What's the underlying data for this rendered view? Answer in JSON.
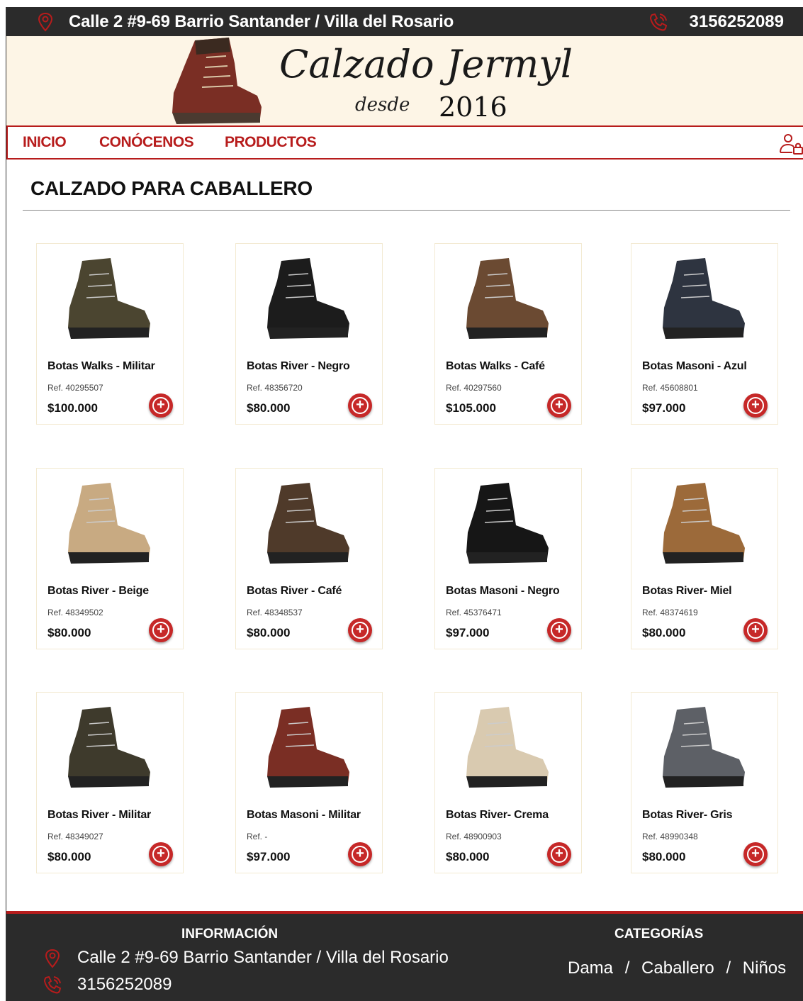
{
  "topbar": {
    "address": "Calle 2 #9-69 Barrio Santander / Villa del Rosario",
    "phone": "3156252089"
  },
  "header": {
    "brand": "Calzado Jermyl",
    "since_label": "desde",
    "since_year": "2016"
  },
  "nav": {
    "items": [
      "INICIO",
      "CONÓCENOS",
      "PRODUCTOS"
    ]
  },
  "section_title": "CALZADO PARA CABALLERO",
  "products": [
    {
      "name": "Botas Walks - Militar",
      "ref": "Ref. 40295507",
      "price": "$100.000",
      "color": "#4b4530"
    },
    {
      "name": "Botas River - Negro",
      "ref": "Ref. 48356720",
      "price": "$80.000",
      "color": "#1c1c1c"
    },
    {
      "name": "Botas Walks - Café",
      "ref": "Ref. 40297560",
      "price": "$105.000",
      "color": "#6b4a32"
    },
    {
      "name": "Botas Masoni - Azul",
      "ref": "Ref. 45608801",
      "price": "$97.000",
      "color": "#2e3440"
    },
    {
      "name": "Botas River - Beige",
      "ref": "Ref. 48349502",
      "price": "$80.000",
      "color": "#c8aa82"
    },
    {
      "name": "Botas River - Café",
      "ref": "Ref. 48348537",
      "price": "$80.000",
      "color": "#4f3a2a"
    },
    {
      "name": "Botas Masoni - Negro",
      "ref": "Ref. 45376471",
      "price": "$97.000",
      "color": "#161616"
    },
    {
      "name": "Botas River- Miel",
      "ref": "Ref. 48374619",
      "price": "$80.000",
      "color": "#9c6a3a"
    },
    {
      "name": "Botas River - Militar",
      "ref": "Ref. 48349027",
      "price": "$80.000",
      "color": "#3e3a2c"
    },
    {
      "name": "Botas Masoni - Militar",
      "ref": "Ref. -",
      "price": "$97.000",
      "color": "#7a2e24"
    },
    {
      "name": "Botas River- Crema",
      "ref": "Ref. 48900903",
      "price": "$80.000",
      "color": "#d9cab0"
    },
    {
      "name": "Botas River- Gris",
      "ref": "Ref. 48990348",
      "price": "$80.000",
      "color": "#5d6066"
    }
  ],
  "footer": {
    "info_title": "INFORMACIÓN",
    "address": "Calle 2 #9-69 Barrio Santander / Villa del Rosario",
    "phone": "3156252089",
    "categories_title": "CATEGORÍAS",
    "categories": [
      "Dama",
      "Caballero",
      "Niños"
    ],
    "separator": "/"
  },
  "colors": {
    "accent": "#b71c1c",
    "dark": "#2b2b2b",
    "header_bg": "#fdf5e6"
  }
}
